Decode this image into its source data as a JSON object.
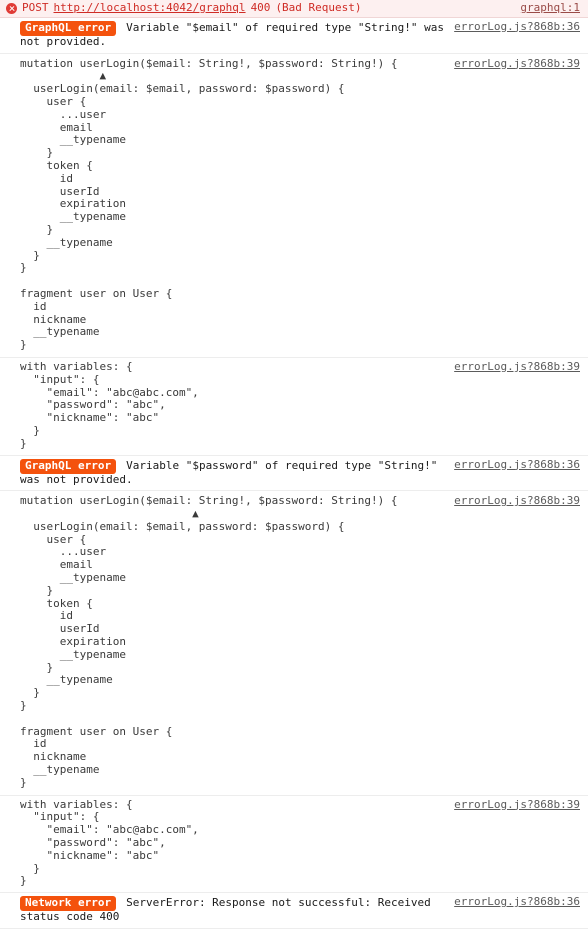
{
  "network_request": {
    "icon": "error-circle-icon",
    "method": "POST",
    "url": "http://localhost:4042/graphql",
    "status_code": "400",
    "status_text": "(Bad Request)",
    "source_link": "graphql:1"
  },
  "colors": {
    "error_row_bg": "#fdf0f0",
    "error_text": "#cf2c26",
    "badge_bg": "#f4520d",
    "badge_text": "#ffffff",
    "icon_bg": "#e03b36",
    "code_text": "#3a3a3a",
    "link_text": "#5b5b5b",
    "separator": "#ededed"
  },
  "entries": [
    {
      "type": "badge",
      "badge": "GraphQL error",
      "message": "Variable \"$email\" of required type \"String!\" was not provided.",
      "source_link": "errorLog.js?868b:36"
    },
    {
      "type": "code",
      "code": "mutation userLogin($email: String!, $password: String!) {\n            ▲\n  userLogin(email: $email, password: $password) {\n    user {\n      ...user\n      email\n      __typename\n    }\n    token {\n      id\n      userId\n      expiration\n      __typename\n    }\n    __typename\n  }\n}\n\nfragment user on User {\n  id\n  nickname\n  __typename\n}",
      "source_link": "errorLog.js?868b:39"
    },
    {
      "type": "vars",
      "code": "with variables: {\n  \"input\": {\n    \"email\": \"abc@abc.com\",\n    \"password\": \"abc\",\n    \"nickname\": \"abc\"\n  }\n}",
      "source_link": "errorLog.js?868b:39"
    },
    {
      "type": "badge",
      "badge": "GraphQL error",
      "message": "Variable \"$password\" of required type \"String!\" was not provided.",
      "source_link": "errorLog.js?868b:36"
    },
    {
      "type": "code",
      "code": "mutation userLogin($email: String!, $password: String!) {\n                          ▲\n  userLogin(email: $email, password: $password) {\n    user {\n      ...user\n      email\n      __typename\n    }\n    token {\n      id\n      userId\n      expiration\n      __typename\n    }\n    __typename\n  }\n}\n\nfragment user on User {\n  id\n  nickname\n  __typename\n}",
      "source_link": "errorLog.js?868b:39"
    },
    {
      "type": "vars",
      "code": "with variables: {\n  \"input\": {\n    \"email\": \"abc@abc.com\",\n    \"password\": \"abc\",\n    \"nickname\": \"abc\"\n  }\n}",
      "source_link": "errorLog.js?868b:39"
    },
    {
      "type": "badge",
      "badge": "Network error",
      "message": "ServerError: Response not successful: Received status code 400",
      "source_link": "errorLog.js?868b:36"
    }
  ]
}
